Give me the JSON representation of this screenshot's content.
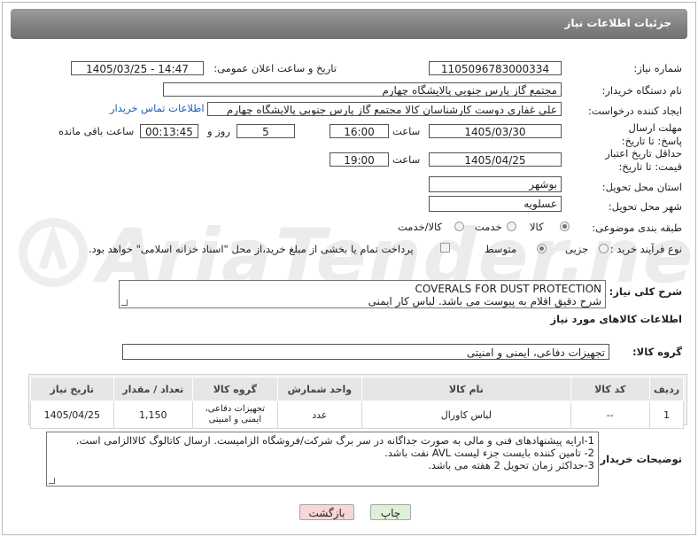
{
  "title": "جزئیات اطلاعات نیاز",
  "fields": {
    "need_number_label": "شماره نیاز:",
    "need_number": "1105096783000334",
    "announce_label": "تاریخ و ساعت اعلان عمومی:",
    "announce_value": "1405/03/25 - 14:47",
    "buyer_label": "نام دستگاه خریدار:",
    "buyer_value": "مجتمع گاز پارس جنوبی  پالایشگاه چهارم",
    "creator_label": "ایجاد کننده درخواست:",
    "creator_value": "علی غفاری دوست کارشناسان کالا مجتمع گاز پارس جنوبی  پالایشگاه چهارم",
    "contact_link": "اطلاعات تماس خریدار",
    "deadline_label": "مهلت ارسال پاسخ: تا تاریخ:",
    "deadline_date": "1405/03/30",
    "time_label": "ساعت",
    "deadline_time": "16:00",
    "days_value": "5",
    "days_label": "روز و",
    "remaining_value": "00:13:45",
    "remaining_label": "ساعت باقی مانده",
    "validity_label": "حداقل تاریخ اعتبار قیمت: تا تاریخ:",
    "validity_date": "1405/04/25",
    "validity_time": "19:00",
    "province_label": "استان محل تحویل:",
    "province_value": "بوشهر",
    "city_label": "شهر محل تحویل:",
    "city_value": "عسلویه",
    "category_label": "طبقه بندی موضوعی:",
    "category_options": [
      "کالا",
      "خدمت",
      "کالا/خدمت"
    ],
    "process_label": "نوع فرآیند خرید :",
    "process_options": [
      "جزیی",
      "متوسط"
    ],
    "payment_note": "پرداخت تمام یا بخشی از مبلغ خرید،از محل \"اسناد خزانه اسلامی\" خواهد بود."
  },
  "description": {
    "label": "شرح کلی نیاز:",
    "line1": "COVERALS FOR DUST PROTECTION",
    "line2": "شرح دقیق اقلام به پیوست می باشد. لباس کار ایمنی"
  },
  "goods": {
    "section_title": "اطلاعات کالاهای مورد نیاز",
    "group_label": "گروه کالا:",
    "group_value": "تجهیزات دفاعی، ایمنی و امنیتی",
    "headers": [
      "ردیف",
      "کد کالا",
      "نام کالا",
      "واحد شمارش",
      "گروه کالا",
      "تعداد / مقدار",
      "تاریخ نیاز"
    ],
    "rows": [
      {
        "row": "1",
        "code": "--",
        "name": "لباس کاورال",
        "unit": "عدد",
        "group": "تجهیزات دفاعی، ایمنی و امنیتی",
        "qty": "1,150",
        "date": "1405/04/25"
      }
    ]
  },
  "buyer_notes": {
    "label": "توضیحات خریدار:",
    "line1": "1-ارایه پیشنهادهای فنی و مالی به صورت جداگانه در سر برگ شرکت/فروشگاه الزامیست. ارسال کاتالوگ کالاالزامی است.",
    "line2": "2- تامین کننده بایست جزء لیست AVL نفت باشد.",
    "line3": "3-حداکثر زمان تحویل 2 هفته می باشد."
  },
  "buttons": {
    "print": "چاپ",
    "back": "بازگشت"
  },
  "watermark": "AriaTender.net"
}
